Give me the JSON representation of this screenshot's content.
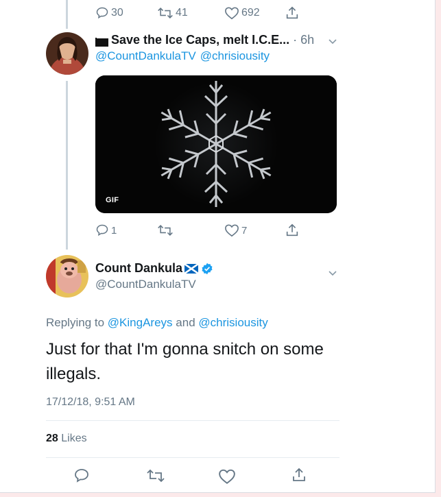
{
  "prev_tweet": {
    "reply_count": "30",
    "retweet_count": "41",
    "like_count": "692"
  },
  "reply_tweet": {
    "display_name": "Save the Ice Caps, melt I.C.E...",
    "time": "· 6h",
    "handles": [
      "@CountDankulaTV",
      "@chrisiousity"
    ],
    "media_badge": "GIF",
    "reply_count": "1",
    "retweet_count": "",
    "like_count": "7"
  },
  "main_tweet": {
    "display_name": "Count Dankula",
    "handle": "@CountDankulaTV",
    "replying_prefix": "Replying to",
    "replying_to": [
      "@KingAreys",
      "@chrisiousity"
    ],
    "replying_and": "and",
    "text_line1": "Just for that I'm gonna snitch on some",
    "text_line2": "illegals.",
    "timestamp": "17/12/18, 9:51 AM",
    "likes_count": "28",
    "likes_label": "Likes"
  },
  "colors": {
    "link_blue": "#1b95e0",
    "muted_gray": "#657786",
    "verified_blue": "#1da1f2",
    "thread_line": "#ccd6dd"
  }
}
